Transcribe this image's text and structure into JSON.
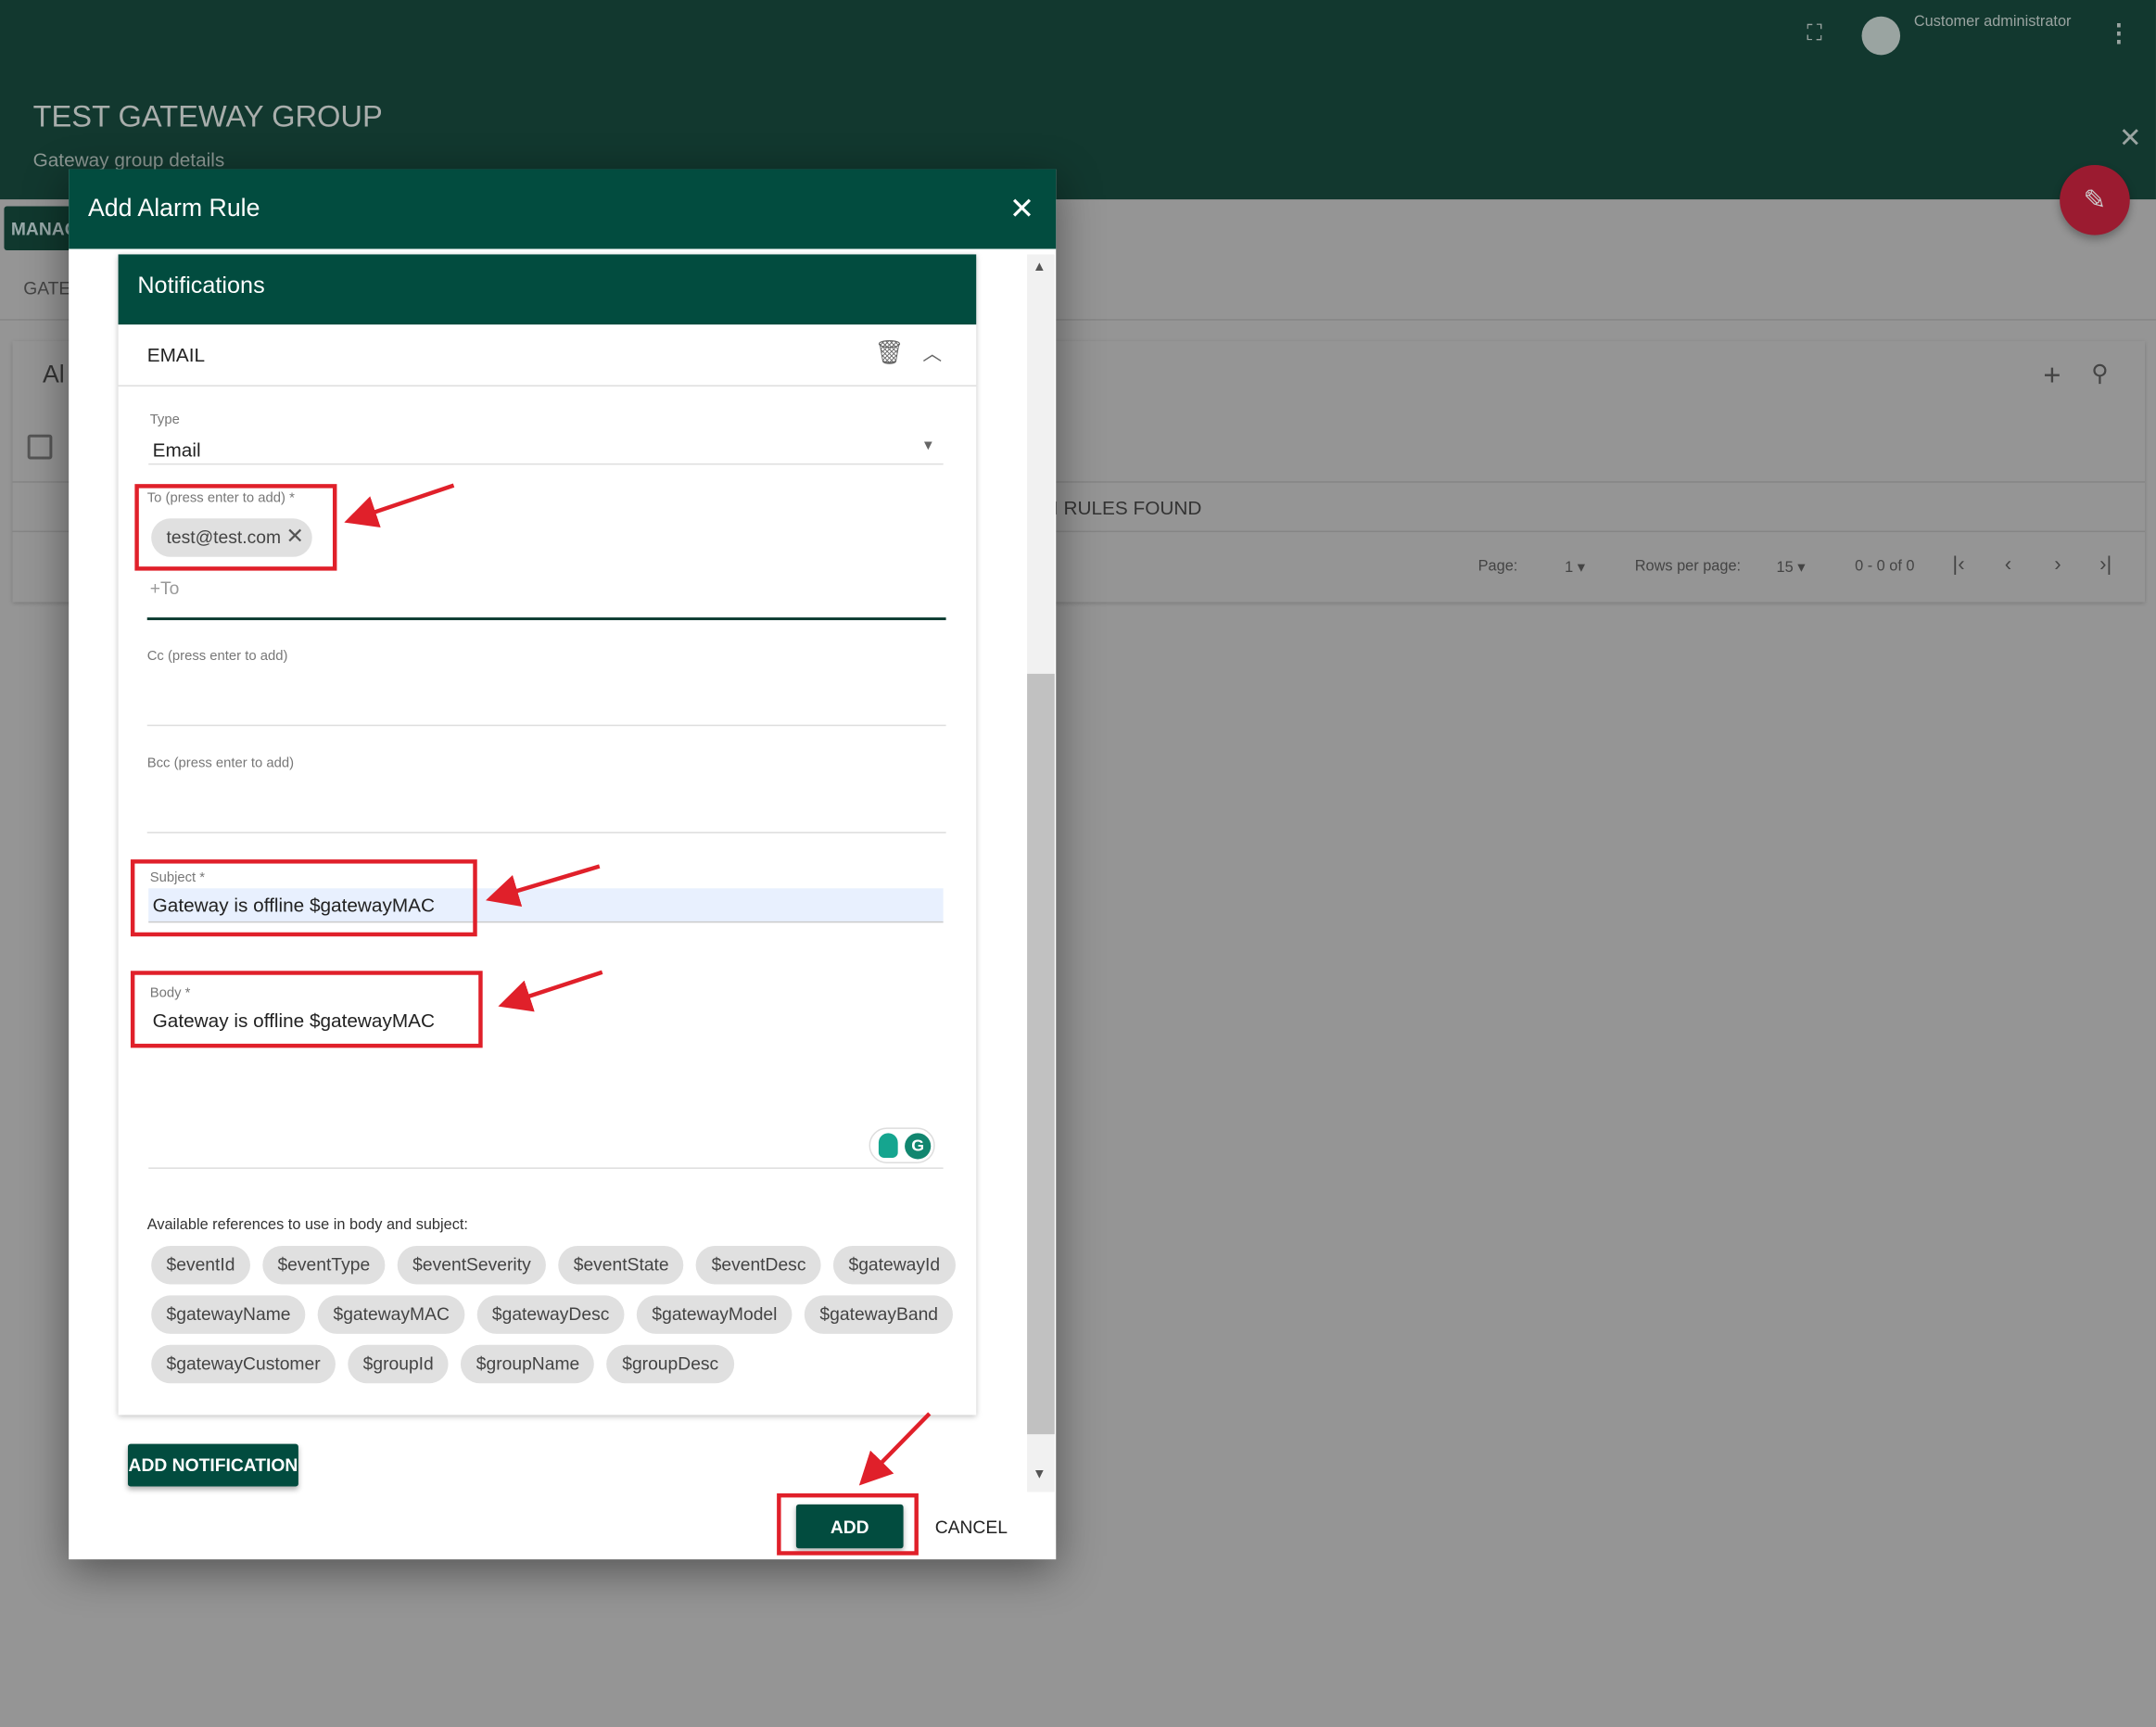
{
  "page": {
    "title": "TEST GATEWAY GROUP",
    "subtitle": "Gateway group details",
    "user": "Customer administrator",
    "manage_tab": "MANAG",
    "gateways_tab": "GATE",
    "card_title": "Al",
    "rules_found": "M RULES FOUND",
    "pagination": {
      "page_label": "Page:",
      "page": "1",
      "rows_label": "Rows per page:",
      "rows": "15",
      "range": "0 - 0 of 0"
    }
  },
  "dialog": {
    "title": "Add Alarm Rule",
    "notifications_title": "Notifications",
    "notification": {
      "name": "EMAIL",
      "type_label": "Type",
      "type_value": "Email",
      "to_label": "To (press enter to add) *",
      "to_chips": [
        "test@test.com"
      ],
      "to_placeholder": "+To",
      "cc_label": "Cc (press enter to add)",
      "bcc_label": "Bcc (press enter to add)",
      "subject_label": "Subject *",
      "subject_value": "Gateway is offline $gatewayMAC",
      "body_label": "Body *",
      "body_value": "Gateway is offline $gatewayMAC",
      "refs_label": "Available references to use in body and subject:",
      "refs": [
        [
          "$eventId",
          "$eventType",
          "$eventSeverity",
          "$eventState",
          "$eventDesc",
          "$gatewayId"
        ],
        [
          "$gatewayName",
          "$gatewayMAC",
          "$gatewayDesc",
          "$gatewayModel",
          "$gatewayBand"
        ],
        [
          "$gatewayCustomer",
          "$groupId",
          "$groupName",
          "$groupDesc"
        ]
      ]
    },
    "add_notification": "ADD NOTIFICATION",
    "add": "ADD",
    "cancel": "CANCEL"
  },
  "colors": {
    "primary": "#024c3f",
    "fab": "#9b1b30",
    "annotation": "#e0202a"
  }
}
